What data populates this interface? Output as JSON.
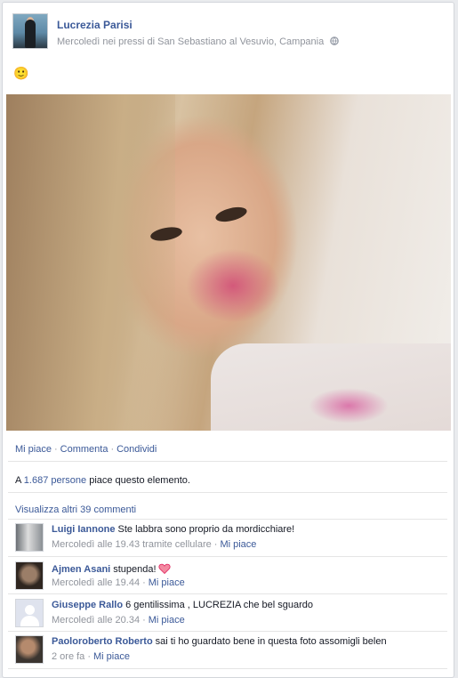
{
  "post": {
    "author": "Lucrezia Parisi",
    "subline": "Mercoledì nei pressi di San Sebastiano al Vesuvio, Campania",
    "privacy_icon": "globe-icon",
    "emoji_icon": "smiley-icon",
    "emoji": "🙂"
  },
  "actions": {
    "like": "Mi piace",
    "comment": "Commenta",
    "share": "Condividi",
    "separator": "·"
  },
  "likes": {
    "prefix": "A ",
    "count": "1.687 persone",
    "suffix": " piace questo elemento."
  },
  "more_comments": "Visualizza altri 39 commenti",
  "comments": [
    {
      "author": "Luigi Iannone",
      "text": "Ste labbra sono proprio da mordicchiare!",
      "time": "Mercoledì alle 19.43 tramite cellulare",
      "like": "Mi piace"
    },
    {
      "author": "Ajmen Asani",
      "text": "stupenda!",
      "icon": "heart-icon",
      "time": "Mercoledì alle 19.44",
      "like": "Mi piace"
    },
    {
      "author": "Giuseppe Rallo",
      "text": "6 gentilissima , LUCREZIA che bel sguardo",
      "time": "Mercoledì alle 20.34",
      "like": "Mi piace"
    },
    {
      "author": "Paoloroberto Roberto",
      "text": "sai ti ho guardato bene in questa foto assomigli belen",
      "time": "2 ore fa",
      "like": "Mi piace"
    }
  ],
  "colors": {
    "link": "#3b5998",
    "meta": "#90949c",
    "heart": "#e0245e"
  }
}
